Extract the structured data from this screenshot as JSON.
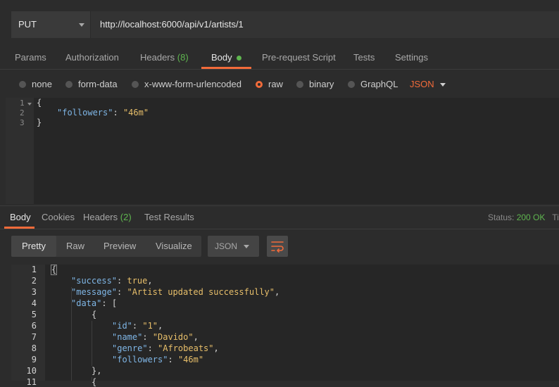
{
  "request": {
    "method": "PUT",
    "url": "http://localhost:6000/api/v1/artists/1"
  },
  "request_tabs": [
    {
      "label": "Params"
    },
    {
      "label": "Authorization"
    },
    {
      "label": "Headers",
      "count": "(8)"
    },
    {
      "label": "Body"
    },
    {
      "label": "Pre-request Script"
    },
    {
      "label": "Tests"
    },
    {
      "label": "Settings"
    }
  ],
  "body_types": [
    "none",
    "form-data",
    "x-www-form-urlencoded",
    "raw",
    "binary",
    "GraphQL"
  ],
  "selected_body_type": "raw",
  "raw_format": "JSON",
  "request_body": {
    "line_numbers": [
      "1",
      "2",
      "3"
    ],
    "open_brace": "{",
    "key": "\"followers\"",
    "colon": ": ",
    "value": "\"46m\"",
    "close_brace": "}"
  },
  "response_tabs": [
    {
      "label": "Body"
    },
    {
      "label": "Cookies"
    },
    {
      "label": "Headers",
      "count": "(2)"
    },
    {
      "label": "Test Results"
    }
  ],
  "status": {
    "label": "Status:",
    "value": "200 OK",
    "next": "Ti"
  },
  "view_modes": [
    "Pretty",
    "Raw",
    "Preview",
    "Visualize"
  ],
  "response_format": "JSON",
  "response_lines": [
    "1",
    "2",
    "3",
    "4",
    "5",
    "6",
    "7",
    "8",
    "9",
    "10",
    "11"
  ],
  "response": {
    "open": "{",
    "success_key": "\"success\"",
    "success_val": "true",
    "message_key": "\"message\"",
    "message_val": "\"Artist updated successfully\"",
    "data_key": "\"data\"",
    "data_open": "[",
    "obj_open": "{",
    "id_key": "\"id\"",
    "id_val": "\"1\"",
    "name_key": "\"name\"",
    "name_val": "\"Davido\"",
    "genre_key": "\"genre\"",
    "genre_val": "\"Afrobeats\"",
    "followers_key": "\"followers\"",
    "followers_val": "\"46m\"",
    "obj_close": "},",
    "obj_open2": "{"
  }
}
